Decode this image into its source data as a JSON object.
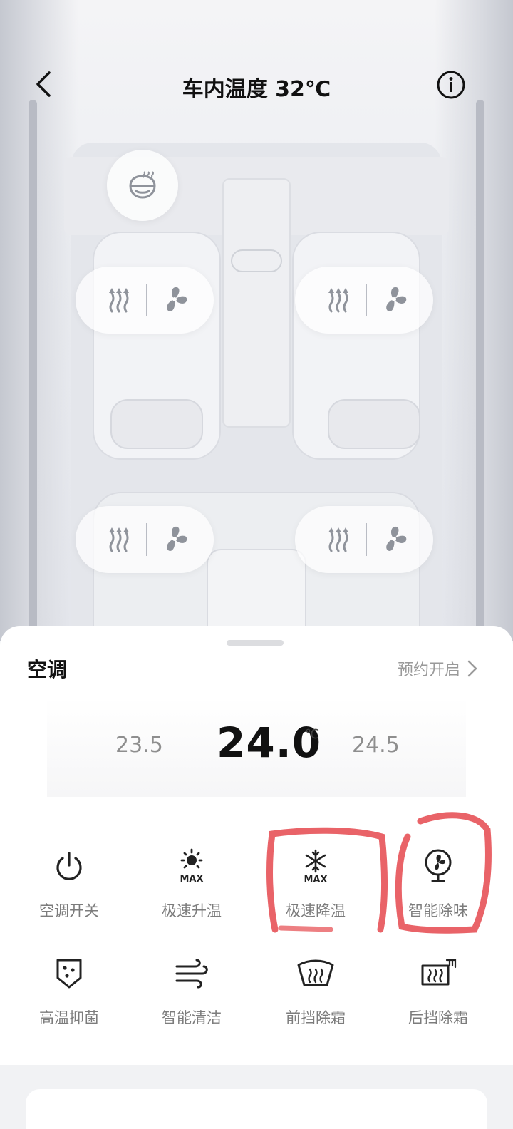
{
  "header": {
    "title": "车内温度 32℃"
  },
  "climate": {
    "title": "空调",
    "schedule_label": "预约开启",
    "temp_lower": "23.5",
    "temp_current": "24.0",
    "temp_unit": "℃",
    "temp_higher": "24.5"
  },
  "functions": [
    {
      "label": "空调开关",
      "icon": "power-icon"
    },
    {
      "label": "极速升温",
      "icon": "sun-max-icon"
    },
    {
      "label": "极速降温",
      "icon": "snowflake-max-icon"
    },
    {
      "label": "智能除味",
      "icon": "fan-icon"
    },
    {
      "label": "高温抑菌",
      "icon": "shield-dots-icon"
    },
    {
      "label": "智能清洁",
      "icon": "wind-icon"
    },
    {
      "label": "前挡除霜",
      "icon": "front-defrost-icon"
    },
    {
      "label": "后挡除霜",
      "icon": "rear-defrost-icon"
    }
  ],
  "icons": {
    "max_text": "MAX"
  },
  "colors": {
    "annotation": "#e5484d"
  }
}
